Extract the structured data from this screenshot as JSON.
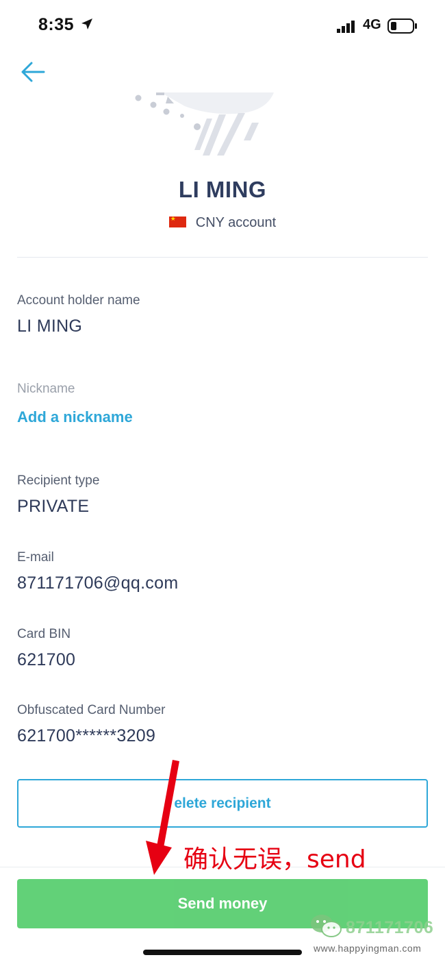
{
  "status_bar": {
    "time": "8:35",
    "network": "4G",
    "icons": [
      "location-arrow-icon",
      "signal-icon",
      "battery-icon"
    ]
  },
  "header": {
    "back_icon": "back-arrow-icon"
  },
  "recipient": {
    "name": "LI MING",
    "account_label": "CNY account",
    "flag": "china-flag-icon"
  },
  "fields": {
    "account_holder": {
      "label": "Account holder name",
      "value": "LI MING"
    },
    "nickname": {
      "label": "Nickname",
      "action": "Add a nickname"
    },
    "recipient_type": {
      "label": "Recipient type",
      "value": "PRIVATE"
    },
    "email": {
      "label": "E-mail",
      "value": "871171706@qq.com"
    },
    "card_bin": {
      "label": "Card BIN",
      "value": "621700"
    },
    "card_number": {
      "label": "Obfuscated Card Number",
      "value": "621700******3209"
    }
  },
  "actions": {
    "delete_label": "elete recipient",
    "send_label": "Send money"
  },
  "annotation": {
    "text": "确认无误，send"
  },
  "watermark": {
    "number": "871171706",
    "url": "www.happyingman.com"
  },
  "colors": {
    "accent": "#2ea7d8",
    "send": "#5ccf73",
    "heading": "#2f3d5f",
    "annotation": "#e60012"
  }
}
